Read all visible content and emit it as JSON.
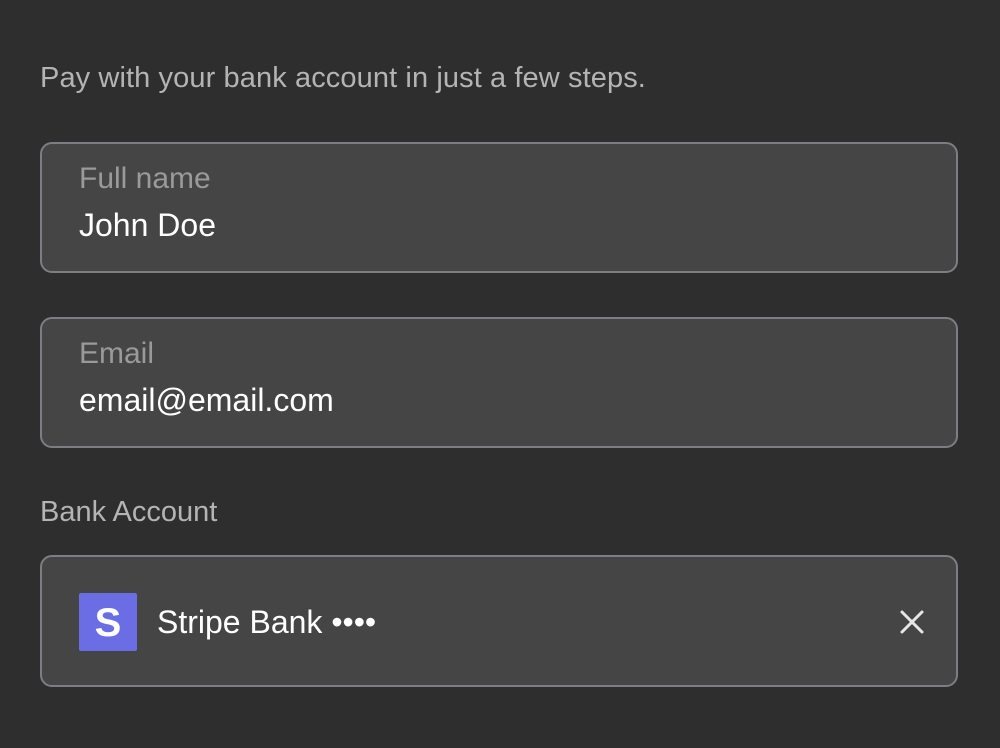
{
  "intro_text": "Pay with your bank account in just a few steps.",
  "full_name": {
    "label": "Full name",
    "value": "John Doe"
  },
  "email": {
    "label": "Email",
    "value": "email@email.com"
  },
  "bank_account": {
    "section_label": "Bank Account",
    "logo_letter": "S",
    "bank_name": "Stripe Bank ••••",
    "remove_icon": "close-icon",
    "logo_color": "#6a6de3"
  },
  "colors": {
    "background": "#2e2e2e",
    "field_background": "#454545",
    "field_border": "#7d7d84",
    "muted_text": "#b4b4b4",
    "value_text": "#ffffff"
  }
}
